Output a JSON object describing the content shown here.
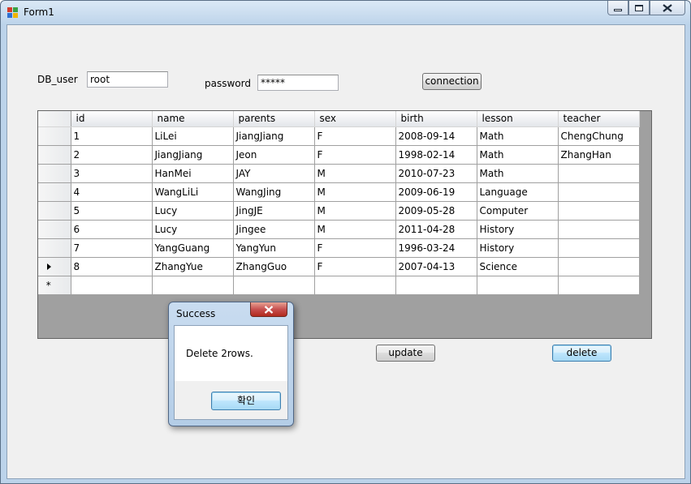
{
  "window": {
    "title": "Form1"
  },
  "form": {
    "db_user_label": "DB_user",
    "db_user_value": "root",
    "password_label": "password",
    "password_value": "*****",
    "connection_button": "connection",
    "update_button": "update",
    "delete_button": "delete"
  },
  "grid": {
    "columns": [
      "id",
      "name",
      "parents",
      "sex",
      "birth",
      "lesson",
      "teacher"
    ],
    "rows": [
      [
        "1",
        "LiLei",
        "JiangJiang",
        "F",
        "2008-09-14",
        "Math",
        "ChengChung"
      ],
      [
        "2",
        "JiangJiang",
        "Jeon",
        "F",
        "1998-02-14",
        "Math",
        "ZhangHan"
      ],
      [
        "3",
        "HanMei",
        "JAY",
        "M",
        "2010-07-23",
        "Math",
        ""
      ],
      [
        "4",
        "WangLiLi",
        "WangJing",
        "M",
        "2009-06-19",
        "Language",
        ""
      ],
      [
        "5",
        "Lucy",
        "JingJE",
        "M",
        "2009-05-28",
        "Computer",
        ""
      ],
      [
        "6",
        "Lucy",
        "Jingee",
        "M",
        "2011-04-28",
        "History",
        ""
      ],
      [
        "7",
        "YangGuang",
        "YangYun",
        "F",
        "1996-03-24",
        "History",
        ""
      ],
      [
        "8",
        "ZhangYue",
        "ZhangGuo",
        "F",
        "2007-04-13",
        "Science",
        ""
      ]
    ],
    "current_row_marker": "▶",
    "new_row_marker": "*"
  },
  "message_box": {
    "title": "Success",
    "text": "Delete 2rows.",
    "ok_button": "확인"
  }
}
